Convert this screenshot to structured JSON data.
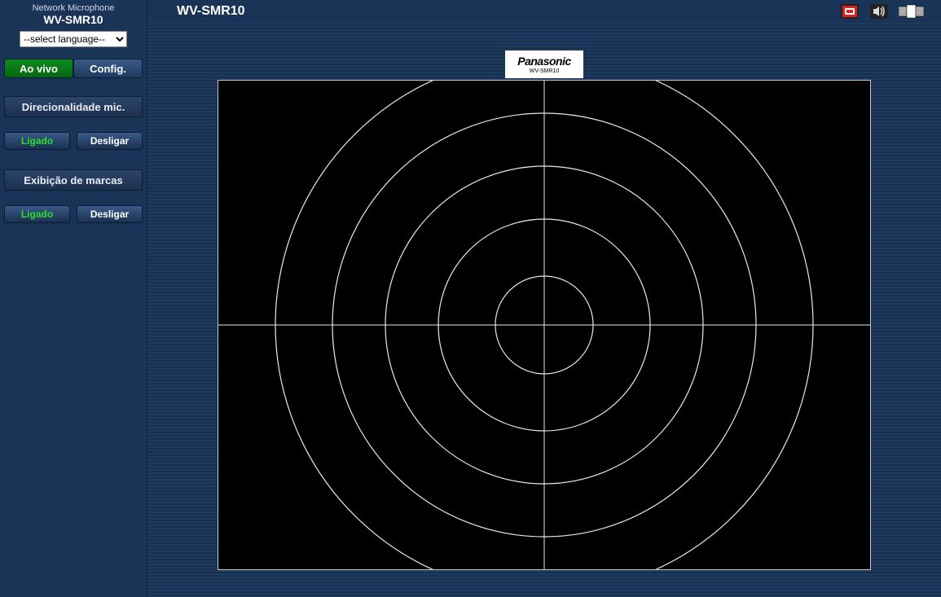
{
  "sidebar": {
    "title": "Network Microphone",
    "model": "WV-SMR10",
    "language_placeholder": "--select language--",
    "tabs": {
      "live": "Ao vivo",
      "config": "Config."
    },
    "section1": {
      "label": "Direcionalidade mic.",
      "on": "Ligado",
      "off": "Desligar"
    },
    "section2": {
      "label": "Exibição de marcas",
      "on": "Ligado",
      "off": "Desligar"
    }
  },
  "main": {
    "title": "WV-SMR10",
    "brand": "Panasonic",
    "brand_model": "WV-SMR10"
  }
}
